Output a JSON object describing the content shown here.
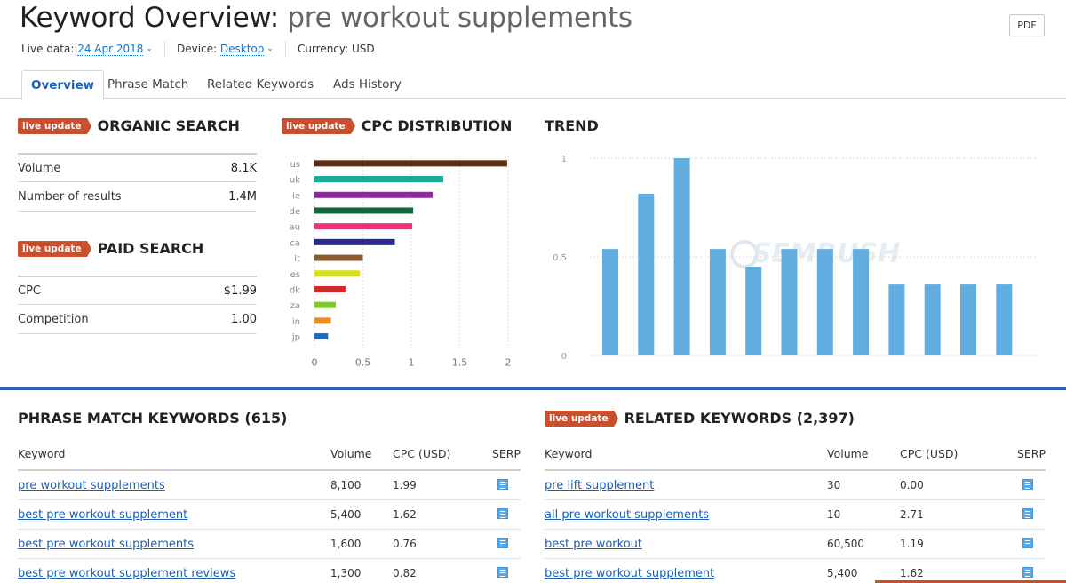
{
  "header": {
    "title_prefix": "Keyword Overview:",
    "keyword": "pre workout supplements",
    "pdf_label": "PDF"
  },
  "meta": {
    "live_data_label": "Live data:",
    "date": "24 Apr 2018",
    "device_label": "Device:",
    "device": "Desktop",
    "currency_label": "Currency:",
    "currency": "USD",
    "chevron_icon": "chevron-down-icon"
  },
  "tabs": [
    {
      "label": "Overview",
      "active": true
    },
    {
      "label": "Phrase Match",
      "active": false
    },
    {
      "label": "Related Keywords",
      "active": false
    },
    {
      "label": "Ads History",
      "active": false
    }
  ],
  "badge_label": "live update",
  "organic": {
    "title": "ORGANIC SEARCH",
    "rows": [
      {
        "label": "Volume",
        "value": "8.1K"
      },
      {
        "label": "Number of results",
        "value": "1.4M"
      }
    ]
  },
  "paid": {
    "title": "PAID SEARCH",
    "rows": [
      {
        "label": "CPC",
        "value": "$1.99"
      },
      {
        "label": "Competition",
        "value": "1.00"
      }
    ]
  },
  "cpc_title": "CPC DISTRIBUTION",
  "trend_title": "TREND",
  "watermark": "SEMRUSH",
  "chart_data": [
    {
      "type": "bar",
      "orientation": "horizontal",
      "title": "CPC DISTRIBUTION",
      "categories": [
        "us",
        "uk",
        "ie",
        "de",
        "au",
        "ca",
        "it",
        "es",
        "dk",
        "za",
        "in",
        "jp"
      ],
      "values": [
        1.99,
        1.33,
        1.22,
        1.02,
        1.01,
        0.83,
        0.5,
        0.47,
        0.32,
        0.22,
        0.17,
        0.14
      ],
      "colors": [
        "#5c2e14",
        "#1aa89a",
        "#8e2a9a",
        "#0e6a3a",
        "#f0307a",
        "#2a2a8e",
        "#8a5a30",
        "#d4e020",
        "#d02a2a",
        "#80c830",
        "#f08a20",
        "#1a6ac8"
      ],
      "xticks": [
        "0",
        "0.5",
        "1",
        "1.5",
        "2"
      ],
      "xlim": [
        0,
        2
      ],
      "grid": true
    },
    {
      "type": "bar",
      "title": "TREND",
      "values": [
        0.54,
        0.82,
        1.0,
        0.54,
        0.45,
        0.54,
        0.54,
        0.54,
        0.36,
        0.36,
        0.36,
        0.36
      ],
      "yticks": [
        "0",
        "0.5",
        "1"
      ],
      "ylim": [
        0,
        1
      ],
      "color": "#62ade0",
      "grid": true
    }
  ],
  "phrase_match": {
    "title": "PHRASE MATCH KEYWORDS (615)",
    "columns": [
      "Keyword",
      "Volume",
      "CPC (USD)",
      "SERP"
    ],
    "rows": [
      {
        "keyword": "pre workout supplements",
        "volume": "8,100",
        "cpc": "1.99"
      },
      {
        "keyword": "best pre workout supplement",
        "volume": "5,400",
        "cpc": "1.62"
      },
      {
        "keyword": "best pre workout supplements",
        "volume": "1,600",
        "cpc": "0.76"
      },
      {
        "keyword": "best pre workout supplement reviews",
        "volume": "1,300",
        "cpc": "0.82"
      }
    ]
  },
  "related": {
    "title": "RELATED KEYWORDS (2,397)",
    "columns": [
      "Keyword",
      "Volume",
      "CPC (USD)",
      "SERP"
    ],
    "rows": [
      {
        "keyword": "pre lift supplement",
        "volume": "30",
        "cpc": "0.00"
      },
      {
        "keyword": "all pre workout supplements",
        "volume": "10",
        "cpc": "2.71"
      },
      {
        "keyword": "best pre workout",
        "volume": "60,500",
        "cpc": "1.19"
      },
      {
        "keyword": "best pre workout supplement",
        "volume": "5,400",
        "cpc": "1.62"
      }
    ]
  }
}
